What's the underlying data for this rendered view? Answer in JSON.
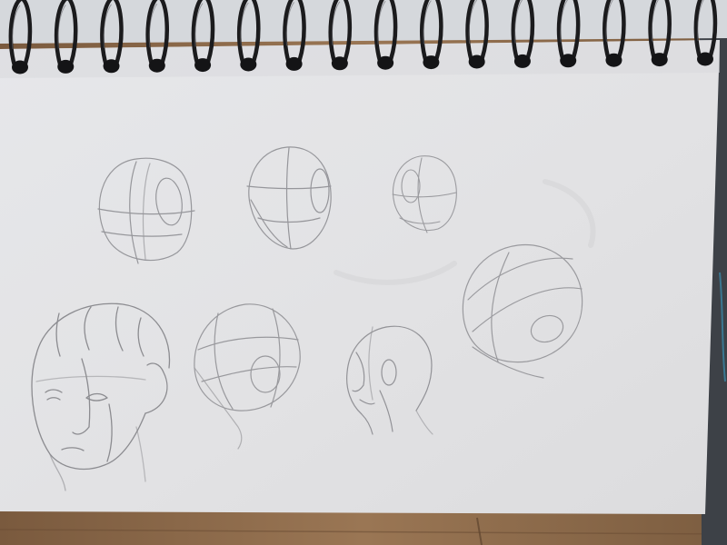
{
  "scene": {
    "description_label": "",
    "colors": {
      "table_wood": "#8b6a4b",
      "paper": "#e4e4e6",
      "pencil": "#7d7d82",
      "binding_wire": "#1b1b1d",
      "cover_board": "#3d4147"
    },
    "binding": {
      "ring_count": 16
    },
    "sketches": [
      {
        "id": "head-front-left-top"
      },
      {
        "id": "head-front-center-top"
      },
      {
        "id": "head-three-quarter-small"
      },
      {
        "id": "head-tilted-right"
      },
      {
        "id": "head-detailed-face"
      },
      {
        "id": "head-side-construction"
      },
      {
        "id": "head-profile-small"
      }
    ]
  }
}
